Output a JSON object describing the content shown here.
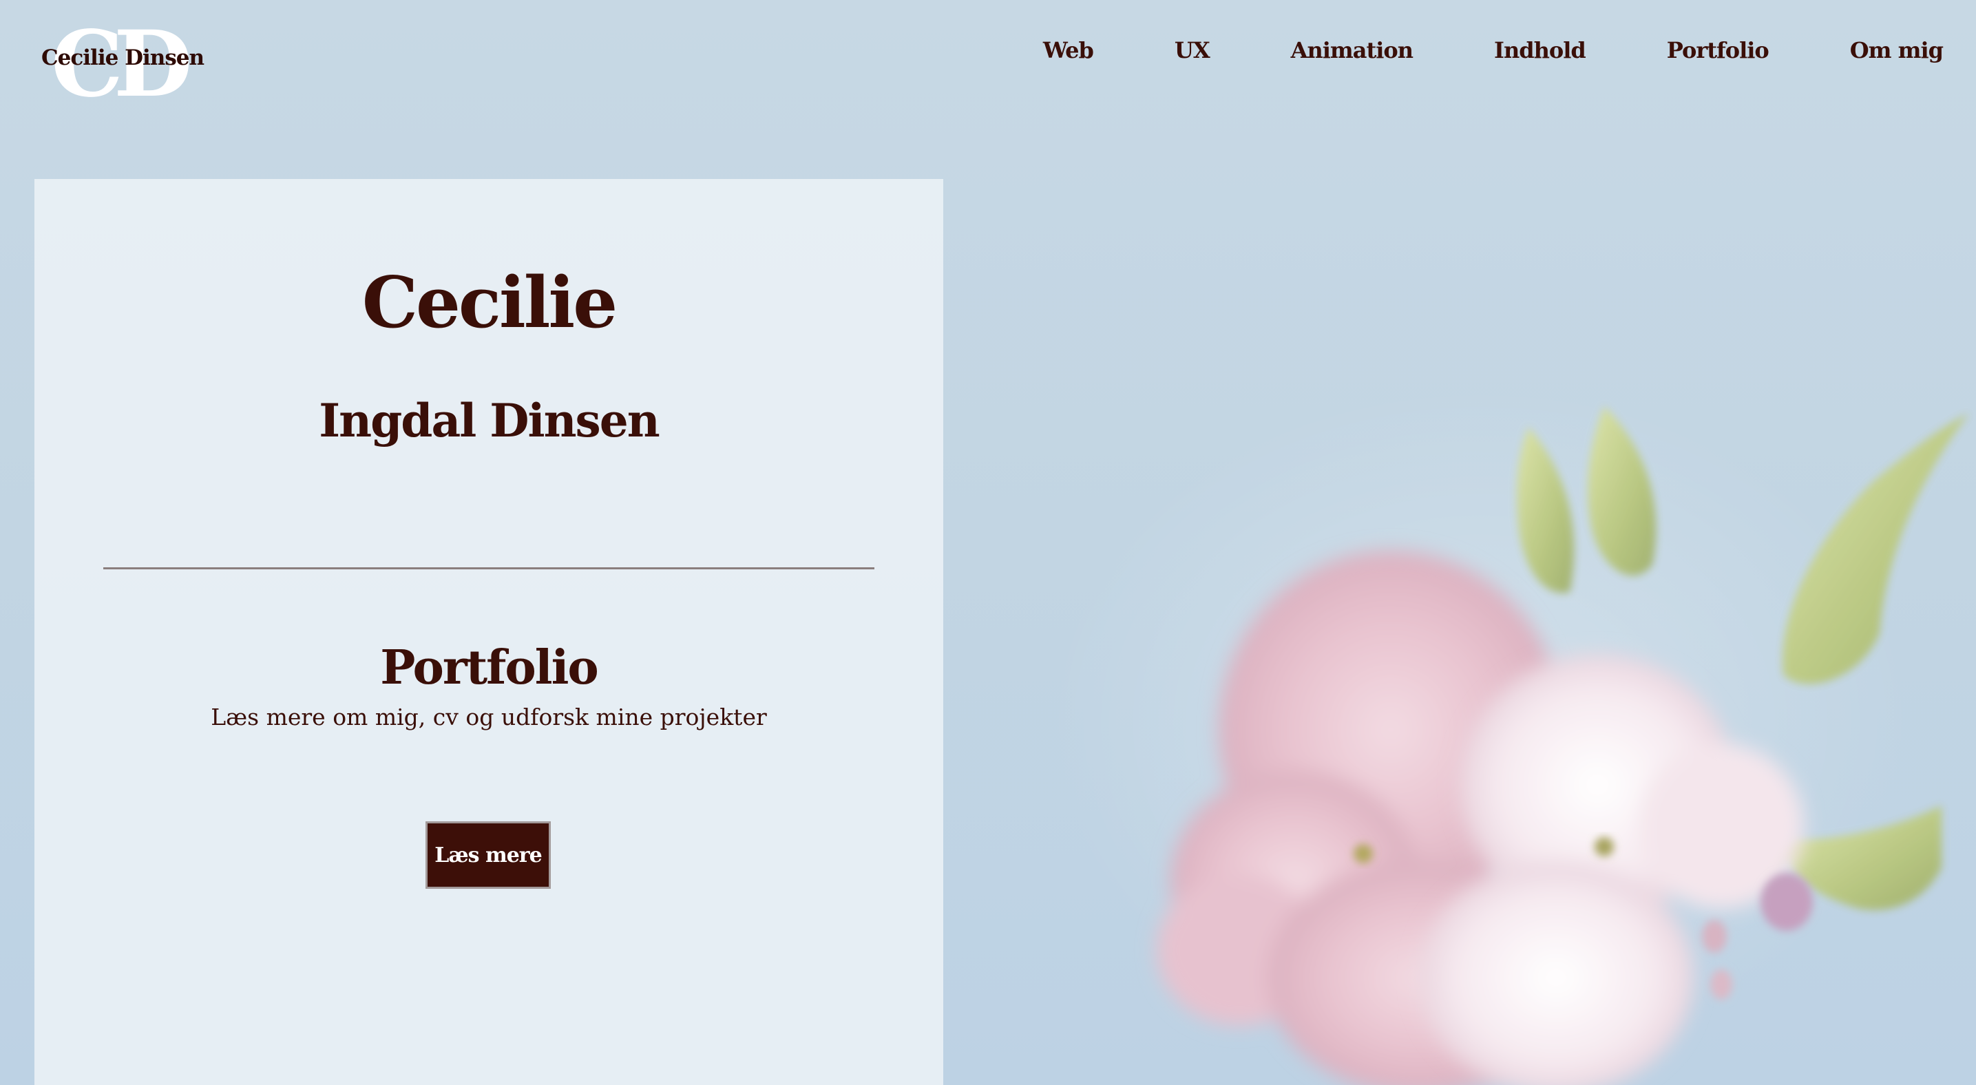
{
  "header": {
    "logo_mark": "CD",
    "logo_text": "Cecilie Dinsen"
  },
  "nav": {
    "items": [
      {
        "label": "Web"
      },
      {
        "label": "UX"
      },
      {
        "label": "Animation"
      },
      {
        "label": "Indhold"
      },
      {
        "label": "Portfolio"
      },
      {
        "label": "Om mig"
      }
    ]
  },
  "hero": {
    "first_name": "Cecilie",
    "last_name": "Ingdal Dinsen",
    "section_title": "Portfolio",
    "section_description": "Læs mere om mig, cv og udforsk mine projekter",
    "cta_label": "Læs mere"
  },
  "colors": {
    "background": "#c6d7e3",
    "text": "#3a0f08",
    "button_bg": "#3d0f08",
    "card_bg": "#ecf2f7"
  },
  "decor": {
    "background_image": "pink-flower-bouquet"
  }
}
